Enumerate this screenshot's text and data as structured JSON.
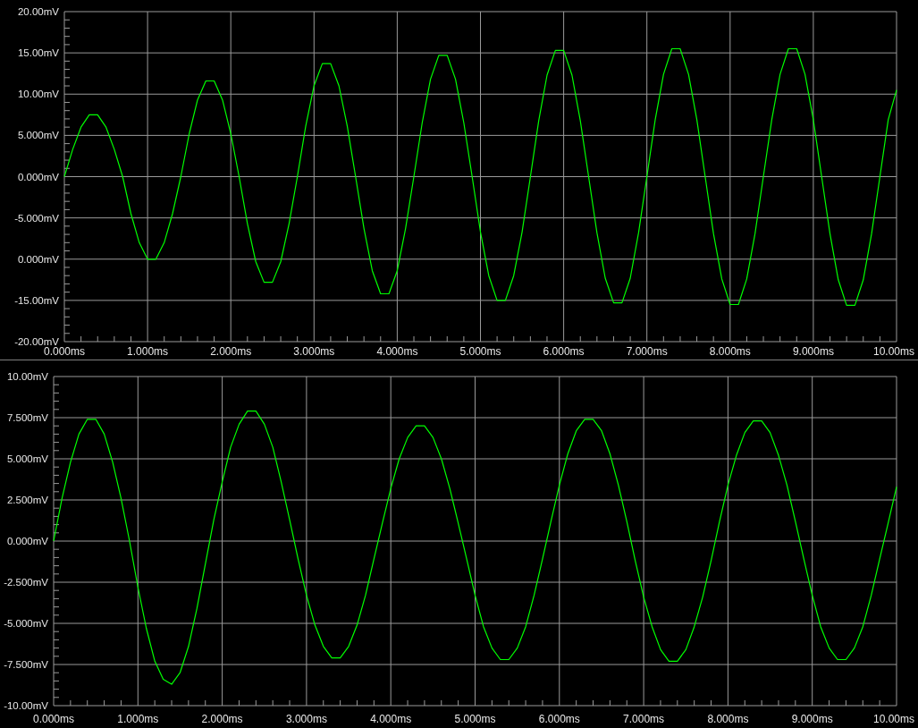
{
  "plots": [
    {
      "unlisted_y_labels": [
        "0.000mV"
      ],
      "chart_data": {
        "type": "line",
        "grid": true,
        "xlim": [
          0,
          10
        ],
        "ylim": [
          -20,
          20
        ],
        "x": [
          0,
          0.1,
          0.2,
          0.3,
          0.4,
          0.5,
          0.6,
          0.7,
          0.8,
          0.9,
          1,
          1.1,
          1.2,
          1.3,
          1.4,
          1.5,
          1.6,
          1.7,
          1.8,
          1.9,
          2,
          2.1,
          2.2,
          2.3,
          2.4,
          2.5,
          2.6,
          2.7,
          2.8,
          2.9,
          3,
          3.1,
          3.2,
          3.3,
          3.4,
          3.5,
          3.6,
          3.7,
          3.8,
          3.9,
          4,
          4.1,
          4.2,
          4.3,
          4.4,
          4.5,
          4.6,
          4.7,
          4.8,
          4.9,
          5,
          5.1,
          5.2,
          5.3,
          5.4,
          5.5,
          5.6,
          5.7,
          5.8,
          5.9,
          6,
          6.1,
          6.2,
          6.3,
          6.4,
          6.5,
          6.6,
          6.7,
          6.8,
          6.9,
          7,
          7.1,
          7.2,
          7.3,
          7.4,
          7.5,
          7.6,
          7.7,
          7.8,
          7.9,
          8,
          8.1,
          8.2,
          8.3,
          8.4,
          8.5,
          8.6,
          8.7,
          8.8,
          8.9,
          9,
          9.1,
          9.2,
          9.3,
          9.4,
          9.5,
          9.6,
          9.7,
          9.8,
          9.9,
          10
        ],
        "xticks": [
          {
            "value": 0,
            "label": "0.000ms"
          },
          {
            "value": 1,
            "label": "1.000ms"
          },
          {
            "value": 2,
            "label": "2.000ms"
          },
          {
            "value": 3,
            "label": "3.000ms"
          },
          {
            "value": 4,
            "label": "4.000ms"
          },
          {
            "value": 5,
            "label": "5.000ms"
          },
          {
            "value": 6,
            "label": "6.000ms"
          },
          {
            "value": 7,
            "label": "7.000ms"
          },
          {
            "value": 8,
            "label": "8.000ms"
          },
          {
            "value": 9,
            "label": "9.000ms"
          },
          {
            "value": 10,
            "label": "10.00ms"
          }
        ],
        "yticks": [
          {
            "value": 20,
            "label": "20.00mV"
          },
          {
            "value": 15,
            "label": "15.00mV"
          },
          {
            "value": 10,
            "label": "10.00mV"
          },
          {
            "value": 5,
            "label": "5.000mV"
          },
          {
            "value": 0,
            "label": "0.000mV"
          },
          {
            "value": -5,
            "label": "-5.000mV"
          },
          {
            "value": -15,
            "label": "-15.00mV"
          },
          {
            "value": -20,
            "label": "-20.00mV"
          }
        ],
        "series": [
          {
            "color": "#00ff00",
            "values": [
              0,
              3.3,
              6,
              7.5,
              7.5,
              6,
              3.3,
              0,
              -4.5,
              -8,
              -10,
              -10,
              -8,
              -4.5,
              0,
              5.2,
              9.3,
              11.6,
              11.6,
              9.3,
              5.2,
              0,
              -5.7,
              -10.3,
              -12.8,
              -12.8,
              -10.3,
              -5.7,
              0,
              6.1,
              11,
              13.7,
              13.7,
              11,
              6.1,
              0,
              -6.3,
              -11.4,
              -14.2,
              -14.2,
              -11.4,
              -6.3,
              0,
              6.5,
              11.8,
              14.7,
              14.7,
              11.8,
              6.5,
              0,
              -6.7,
              -12,
              -15,
              -15,
              -12,
              -6.7,
              0,
              6.8,
              12.3,
              15.3,
              15.3,
              12.3,
              6.8,
              0,
              -6.8,
              -12.3,
              -15.3,
              -15.3,
              -12.3,
              -6.8,
              0,
              6.9,
              12.4,
              15.5,
              15.5,
              12.4,
              6.9,
              0,
              -6.9,
              -12.4,
              -15.5,
              -15.5,
              -12.4,
              -6.9,
              0,
              6.9,
              12.4,
              15.5,
              15.5,
              12.4,
              6.9,
              0,
              -6.9,
              -12.5,
              -15.6,
              -15.6,
              -12.5,
              -6.9,
              0,
              6.9,
              10.5
            ]
          }
        ]
      }
    },
    {
      "chart_data": {
        "type": "line",
        "grid": true,
        "xlim": [
          0,
          10
        ],
        "ylim": [
          -10,
          10
        ],
        "x": [
          0,
          0.1,
          0.2,
          0.3,
          0.4,
          0.5,
          0.6,
          0.7,
          0.8,
          0.9,
          1,
          1.1,
          1.2,
          1.3,
          1.4,
          1.5,
          1.6,
          1.7,
          1.8,
          1.9,
          2,
          2.1,
          2.2,
          2.3,
          2.4,
          2.5,
          2.6,
          2.7,
          2.8,
          2.9,
          3,
          3.1,
          3.2,
          3.3,
          3.4,
          3.5,
          3.6,
          3.7,
          3.8,
          3.9,
          4,
          4.1,
          4.2,
          4.3,
          4.4,
          4.5,
          4.6,
          4.7,
          4.8,
          4.9,
          5,
          5.1,
          5.2,
          5.3,
          5.4,
          5.5,
          5.6,
          5.7,
          5.8,
          5.9,
          6,
          6.1,
          6.2,
          6.3,
          6.4,
          6.5,
          6.6,
          6.7,
          6.8,
          6.9,
          7,
          7.1,
          7.2,
          7.3,
          7.4,
          7.5,
          7.6,
          7.7,
          7.8,
          7.9,
          8,
          8.1,
          8.2,
          8.3,
          8.4,
          8.5,
          8.6,
          8.7,
          8.8,
          8.9,
          9,
          9.1,
          9.2,
          9.3,
          9.4,
          9.5,
          9.6,
          9.7,
          9.8,
          9.9,
          10
        ],
        "xticks": [
          {
            "value": 0,
            "label": "0.000ms"
          },
          {
            "value": 1,
            "label": "1.000ms"
          },
          {
            "value": 2,
            "label": "2.000ms"
          },
          {
            "value": 3,
            "label": "3.000ms"
          },
          {
            "value": 4,
            "label": "4.000ms"
          },
          {
            "value": 5,
            "label": "5.000ms"
          },
          {
            "value": 6,
            "label": "6.000ms"
          },
          {
            "value": 7,
            "label": "7.000ms"
          },
          {
            "value": 8,
            "label": "8.000ms"
          },
          {
            "value": 9,
            "label": "9.000ms"
          },
          {
            "value": 10,
            "label": "10.00ms"
          }
        ],
        "yticks": [
          {
            "value": 10,
            "label": "10.00mV"
          },
          {
            "value": 7.5,
            "label": "7.500mV"
          },
          {
            "value": 5,
            "label": "5.000mV"
          },
          {
            "value": 2.5,
            "label": "2.500mV"
          },
          {
            "value": 0,
            "label": "0.000mV"
          },
          {
            "value": -2.5,
            "label": "-2.500mV"
          },
          {
            "value": -5,
            "label": "-5.000mV"
          },
          {
            "value": -7.5,
            "label": "-7.500mV"
          },
          {
            "value": -10,
            "label": "-10.00mV"
          }
        ],
        "series": [
          {
            "color": "#00ff00",
            "values": [
              0,
              2.6,
              4.8,
              6.5,
              7.4,
              7.4,
              6.5,
              4.8,
              2.6,
              0,
              -2.8,
              -5.3,
              -7.3,
              -8.4,
              -8.7,
              -8,
              -6.4,
              -4.1,
              -1.4,
              1.3,
              3.6,
              5.7,
              7.1,
              7.9,
              7.9,
              7.1,
              5.7,
              3.6,
              1.3,
              -1.1,
              -3.3,
              -5.1,
              -6.4,
              -7.1,
              -7.1,
              -6.4,
              -5.1,
              -3.3,
              -1.1,
              1.1,
              3.2,
              5,
              6.3,
              7,
              7,
              6.3,
              5,
              3.2,
              1.1,
              -1.1,
              -3.3,
              -5.2,
              -6.5,
              -7.2,
              -7.2,
              -6.5,
              -5.2,
              -3.3,
              -1.1,
              1.2,
              3.4,
              5.3,
              6.7,
              7.4,
              7.4,
              6.7,
              5.3,
              3.4,
              1.2,
              -1.2,
              -3.4,
              -5.2,
              -6.6,
              -7.3,
              -7.3,
              -6.6,
              -5.2,
              -3.4,
              -1.2,
              1.2,
              3.4,
              5.2,
              6.6,
              7.3,
              7.3,
              6.6,
              5.2,
              3.4,
              1.2,
              -1.1,
              -3.3,
              -5.2,
              -6.5,
              -7.2,
              -7.2,
              -6.5,
              -5.2,
              -3.3,
              -1.1,
              1.1,
              3.3
            ]
          }
        ]
      }
    }
  ]
}
